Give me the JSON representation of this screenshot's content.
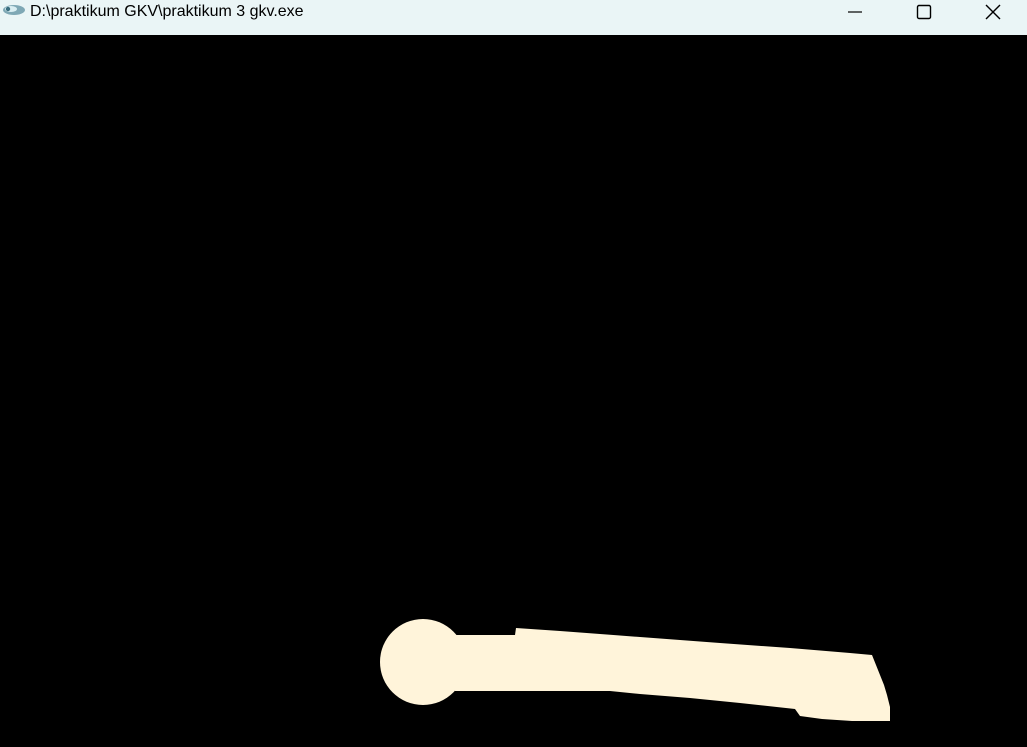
{
  "window": {
    "title": "D:\\praktikum GKV\\praktikum 3 gkv.exe",
    "titlebar_color": "#EAF5F6",
    "controls": {
      "minimize_icon": "minimize-icon",
      "maximize_icon": "maximize-icon",
      "close_icon": "close-icon"
    }
  },
  "canvas": {
    "background": "#000000",
    "shape_color": "#FFF4DA"
  }
}
